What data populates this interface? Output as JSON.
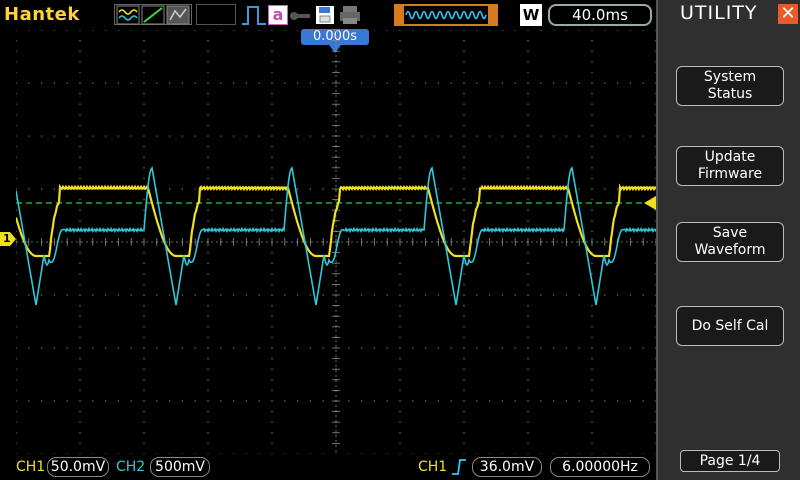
{
  "brand": "Hantek",
  "timebase": "40.0ms",
  "timebase_mode": "W",
  "trigger_position": "0.000s",
  "ch1_marker": "1",
  "sidebar": {
    "title": "UTILITY",
    "buttons": [
      {
        "label": "System\nStatus"
      },
      {
        "label": "Update\nFirmware"
      },
      {
        "label": "Save\nWaveform"
      },
      {
        "label": "Do Self Cal"
      }
    ],
    "page": "Page 1/4"
  },
  "status": {
    "ch1_label": "CH1",
    "ch1_scale": "50.0mV",
    "ch2_label": "CH2",
    "ch2_scale": "500mV",
    "trig_source": "CH1",
    "trig_level": "36.0mV",
    "frequency": "6.00000Hz"
  },
  "colors": {
    "ch1": "#f0e020",
    "ch2": "#30c8d8",
    "accent": "#3a78d6",
    "close": "#e85a2a"
  }
}
